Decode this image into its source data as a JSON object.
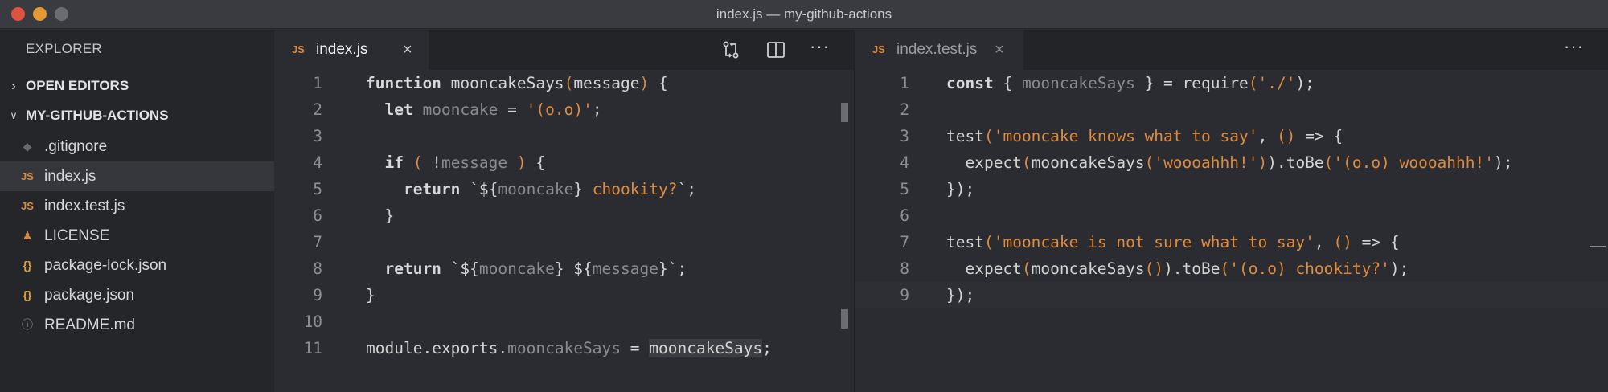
{
  "window": {
    "title": "index.js — my-github-actions"
  },
  "sidebar": {
    "title": "EXPLORER",
    "sections": [
      {
        "label": "OPEN EDITORS",
        "expanded": false
      },
      {
        "label": "MY-GITHUB-ACTIONS",
        "expanded": true
      }
    ],
    "files": [
      {
        "name": ".gitignore",
        "icon": "git-diamond-icon"
      },
      {
        "name": "index.js",
        "icon": "js-file-icon",
        "active": true
      },
      {
        "name": "index.test.js",
        "icon": "js-file-icon"
      },
      {
        "name": "LICENSE",
        "icon": "license-icon"
      },
      {
        "name": "package-lock.json",
        "icon": "json-braces-icon"
      },
      {
        "name": "package.json",
        "icon": "json-braces-icon"
      },
      {
        "name": "README.md",
        "icon": "info-icon"
      }
    ]
  },
  "editor_left": {
    "tab": {
      "badge": "JS",
      "name": "index.js",
      "close": "×"
    },
    "more": "···",
    "line_numbers": [
      "1",
      "2",
      "3",
      "4",
      "5",
      "6",
      "7",
      "8",
      "9",
      "10",
      "11"
    ],
    "lines": [
      [
        "function",
        " ",
        "mooncakeSays",
        "(",
        "message",
        ")",
        " {"
      ],
      [
        "  ",
        "let",
        " ",
        "mooncake",
        " = ",
        "'(o.o)'",
        ";"
      ],
      [
        ""
      ],
      [
        "  ",
        "if",
        " ",
        "(",
        " !",
        "message",
        " ",
        ")",
        " {"
      ],
      [
        "    ",
        "return",
        " `${",
        "mooncake",
        "}",
        " chookity?",
        "`;"
      ],
      [
        "  }"
      ],
      [
        ""
      ],
      [
        "  ",
        "return",
        " `${",
        "mooncake",
        "} ${",
        "message",
        "}",
        "`;"
      ],
      [
        "}"
      ],
      [
        ""
      ],
      [
        "module",
        ".",
        "exports",
        ".",
        "mooncakeSays",
        " = ",
        "mooncakeSays",
        ";"
      ]
    ]
  },
  "editor_right": {
    "tab": {
      "badge": "JS",
      "name": "index.test.js",
      "close": "×"
    },
    "more": "···",
    "line_numbers": [
      "1",
      "2",
      "3",
      "4",
      "5",
      "6",
      "7",
      "8",
      "9"
    ],
    "lines": [
      [
        "const",
        " { ",
        "mooncakeSays",
        " } = ",
        "require",
        "(",
        "'./'",
        ");"
      ],
      [
        ""
      ],
      [
        "test",
        "(",
        "'mooncake knows what to say'",
        ", ",
        "()",
        " => {"
      ],
      [
        "  ",
        "expect",
        "(",
        "mooncakeSays",
        "(",
        "'woooahhh!'",
        ")",
        ").",
        "toBe",
        "(",
        "'(o.o) woooahhh!'",
        ");"
      ],
      [
        "});"
      ],
      [
        ""
      ],
      [
        "test",
        "(",
        "'mooncake is not sure what to say'",
        ", ",
        "()",
        " => {"
      ],
      [
        "  ",
        "expect",
        "(",
        "mooncakeSays",
        "()",
        ").",
        "toBe",
        "(",
        "'(o.o) chookity?'",
        ");"
      ],
      [
        "});"
      ]
    ]
  },
  "colors": {
    "background": "#2b2c31",
    "sidebar": "#25262a",
    "accent_orange": "#e08b3c",
    "muted_identifier": "#8a8b8f"
  }
}
